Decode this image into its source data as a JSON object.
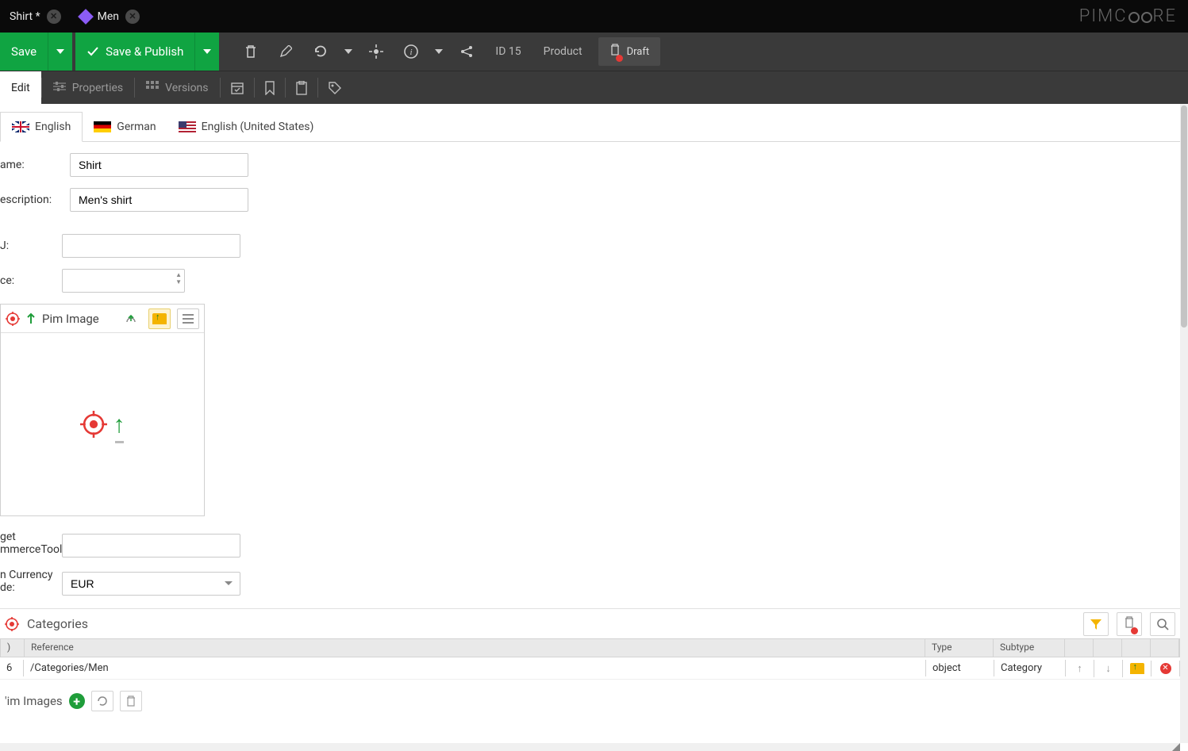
{
  "tabs": [
    {
      "label": "Shirt *"
    },
    {
      "label": "Men"
    }
  ],
  "brand": "PIMC RE",
  "actions": {
    "save": "Save",
    "savepublish": "Save & Publish",
    "id": "ID 15",
    "type": "Product",
    "draft": "Draft"
  },
  "subtabs": {
    "edit": "Edit",
    "properties": "Properties",
    "versions": "Versions"
  },
  "langs": {
    "en": "English",
    "de": "German",
    "us": "English (United States)"
  },
  "form": {
    "name_label": "ame:",
    "name_value": "Shirt",
    "desc_label": "escription:",
    "desc_value": "Men's shirt",
    "sku_label": "J:",
    "sku_value": "",
    "price_label": "ce:",
    "price_value": "",
    "pim_image_title": "Pim Image",
    "target_label_l1": "get",
    "target_label_l2": "mmerceTool)",
    "target_value": "",
    "currency_label_l1": "n Currency",
    "currency_label_l2": "de:",
    "currency_value": "EUR"
  },
  "categories": {
    "title": "Categories",
    "cols": {
      "id": ")",
      "ref": "Reference",
      "type": "Type",
      "sub": "Subtype"
    },
    "rows": [
      {
        "id": "6",
        "ref": "/Categories/Men",
        "type": "object",
        "sub": "Category"
      }
    ]
  },
  "pim_images_title": "'im Images"
}
